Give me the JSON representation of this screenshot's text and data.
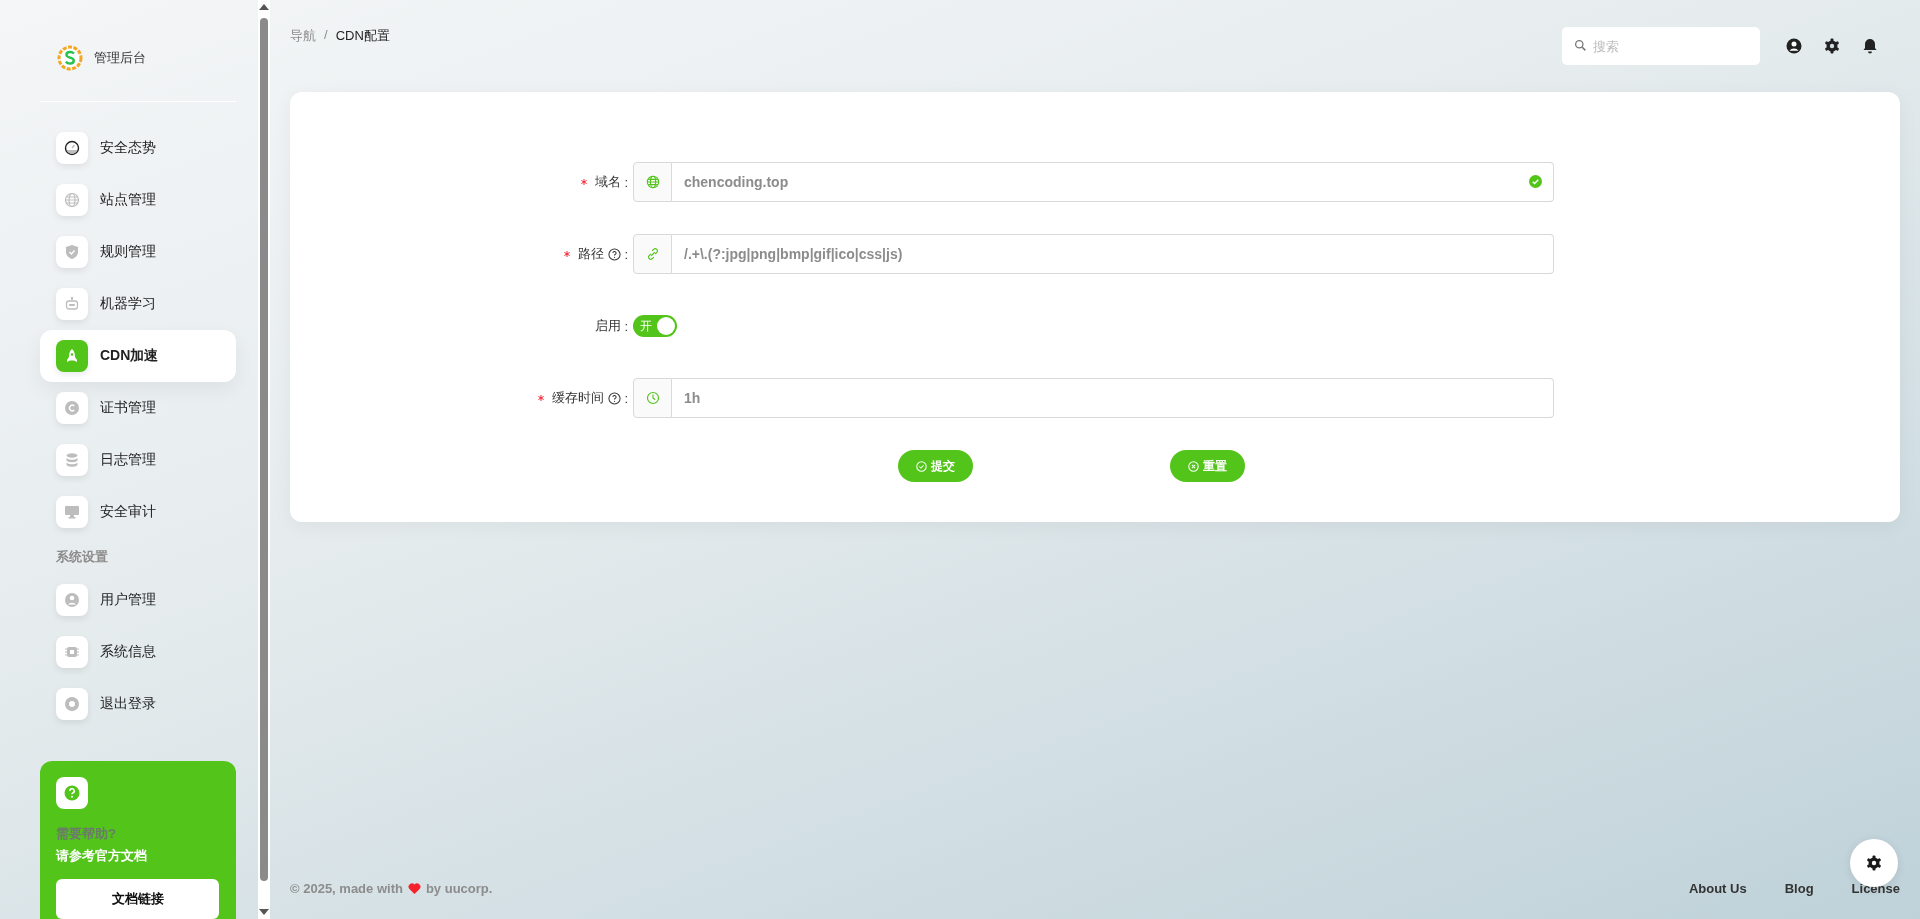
{
  "sidebar": {
    "brand": "管理后台",
    "groups": [
      {
        "items": [
          {
            "label": "安全态势",
            "selected": false
          },
          {
            "label": "站点管理",
            "selected": false
          },
          {
            "label": "规则管理",
            "selected": false
          },
          {
            "label": "机器学习",
            "selected": false
          },
          {
            "label": "CDN加速",
            "selected": true
          },
          {
            "label": "证书管理",
            "selected": false
          },
          {
            "label": "日志管理",
            "selected": false
          },
          {
            "label": "安全审计",
            "selected": false
          }
        ]
      },
      {
        "heading": "系统设置",
        "items": [
          {
            "label": "用户管理",
            "selected": false
          },
          {
            "label": "系统信息",
            "selected": false
          },
          {
            "label": "退出登录",
            "selected": false
          }
        ]
      }
    ],
    "help_card": {
      "title": "需要帮助?",
      "subtitle": "请参考官方文档",
      "button": "文档链接"
    }
  },
  "breadcrumb": {
    "items": [
      "导航",
      "CDN配置"
    ],
    "separator": "/"
  },
  "search": {
    "placeholder": "搜索"
  },
  "form": {
    "fields": [
      {
        "kind": "input",
        "label": "域名",
        "suffix": ":",
        "required": true,
        "help": false,
        "value": "chencoding.top",
        "valid": true
      },
      {
        "kind": "input",
        "label": "路径",
        "suffix": ":",
        "required": true,
        "help": true,
        "value": "/.+\\.(?:jpg|png|bmp|gif|ico|css|js)",
        "valid": false
      },
      {
        "kind": "switch",
        "label": "启用",
        "suffix": ":",
        "required": false,
        "help": false,
        "on": true,
        "text": "开"
      },
      {
        "kind": "input",
        "label": "缓存时间",
        "suffix": ":",
        "required": true,
        "help": true,
        "value": "1h",
        "valid": false
      }
    ],
    "buttons": [
      {
        "kind": "submit",
        "label": "提交"
      },
      {
        "kind": "reset",
        "label": "重置"
      }
    ]
  },
  "footer": {
    "prefix": "© 2025, made with",
    "suffix": "by **uucorp**.",
    "links": [
      "About Us",
      "Blog",
      "License"
    ]
  }
}
